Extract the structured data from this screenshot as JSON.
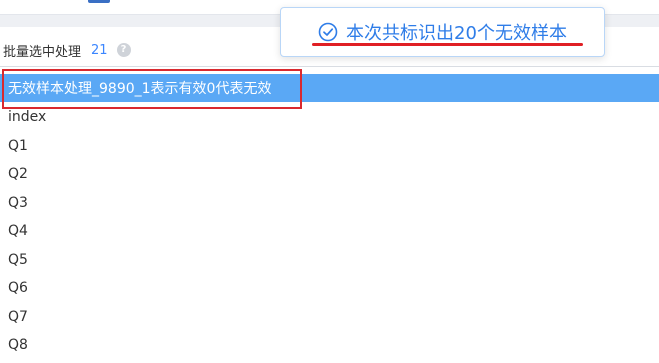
{
  "batch": {
    "label": "批量选中处理",
    "count": "21",
    "help_icon": "question-circle-icon"
  },
  "list": {
    "items": [
      {
        "label": "无效样本处理_9890_1表示有效0代表无效",
        "selected": true
      },
      {
        "label": "index",
        "selected": false
      },
      {
        "label": "Q1",
        "selected": false
      },
      {
        "label": "Q2",
        "selected": false
      },
      {
        "label": "Q3",
        "selected": false
      },
      {
        "label": "Q4",
        "selected": false
      },
      {
        "label": "Q5",
        "selected": false
      },
      {
        "label": "Q6",
        "selected": false
      },
      {
        "label": "Q7",
        "selected": false
      },
      {
        "label": "Q8",
        "selected": false
      }
    ]
  },
  "toast": {
    "icon": "check-circle-icon",
    "message": "本次共标识出20个无效样本"
  },
  "colors": {
    "accent": "#3b86ff",
    "selected_row": "#5aa8f5",
    "annotation_red": "#d9292f",
    "toast_text": "#2f7de8"
  }
}
